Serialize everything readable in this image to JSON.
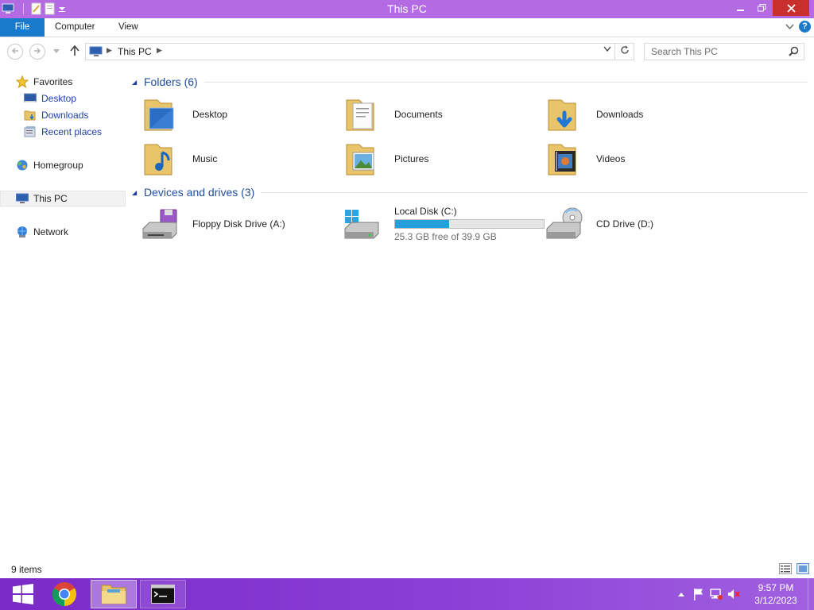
{
  "window": {
    "title": "This PC",
    "accent": "#b36ae3",
    "controls": [
      "minimize",
      "restore",
      "close"
    ]
  },
  "ribbon": {
    "tabs": [
      "File",
      "Computer",
      "View"
    ],
    "help_label": "?"
  },
  "address": {
    "breadcrumb": "This PC",
    "search_placeholder": "Search This PC"
  },
  "nav": {
    "favorites": "Favorites",
    "desktop": "Desktop",
    "downloads": "Downloads",
    "recent": "Recent places",
    "homegroup": "Homegroup",
    "thispc": "This PC",
    "network": "Network"
  },
  "folders": {
    "header": "Folders (6)",
    "items": [
      "Desktop",
      "Documents",
      "Downloads",
      "Music",
      "Pictures",
      "Videos"
    ]
  },
  "devices": {
    "header": "Devices and drives (3)",
    "floppy": "Floppy Disk Drive (A:)",
    "local": {
      "name": "Local Disk (C:)",
      "free_text": "25.3 GB free of 39.9 GB",
      "used_fraction": 0.366
    },
    "cd": "CD Drive (D:)"
  },
  "status": {
    "count": "9 items"
  },
  "taskbar": {
    "apps": [
      "start",
      "chrome",
      "file-explorer",
      "command-prompt"
    ],
    "time": "9:57 PM",
    "date": "3/12/2023"
  }
}
